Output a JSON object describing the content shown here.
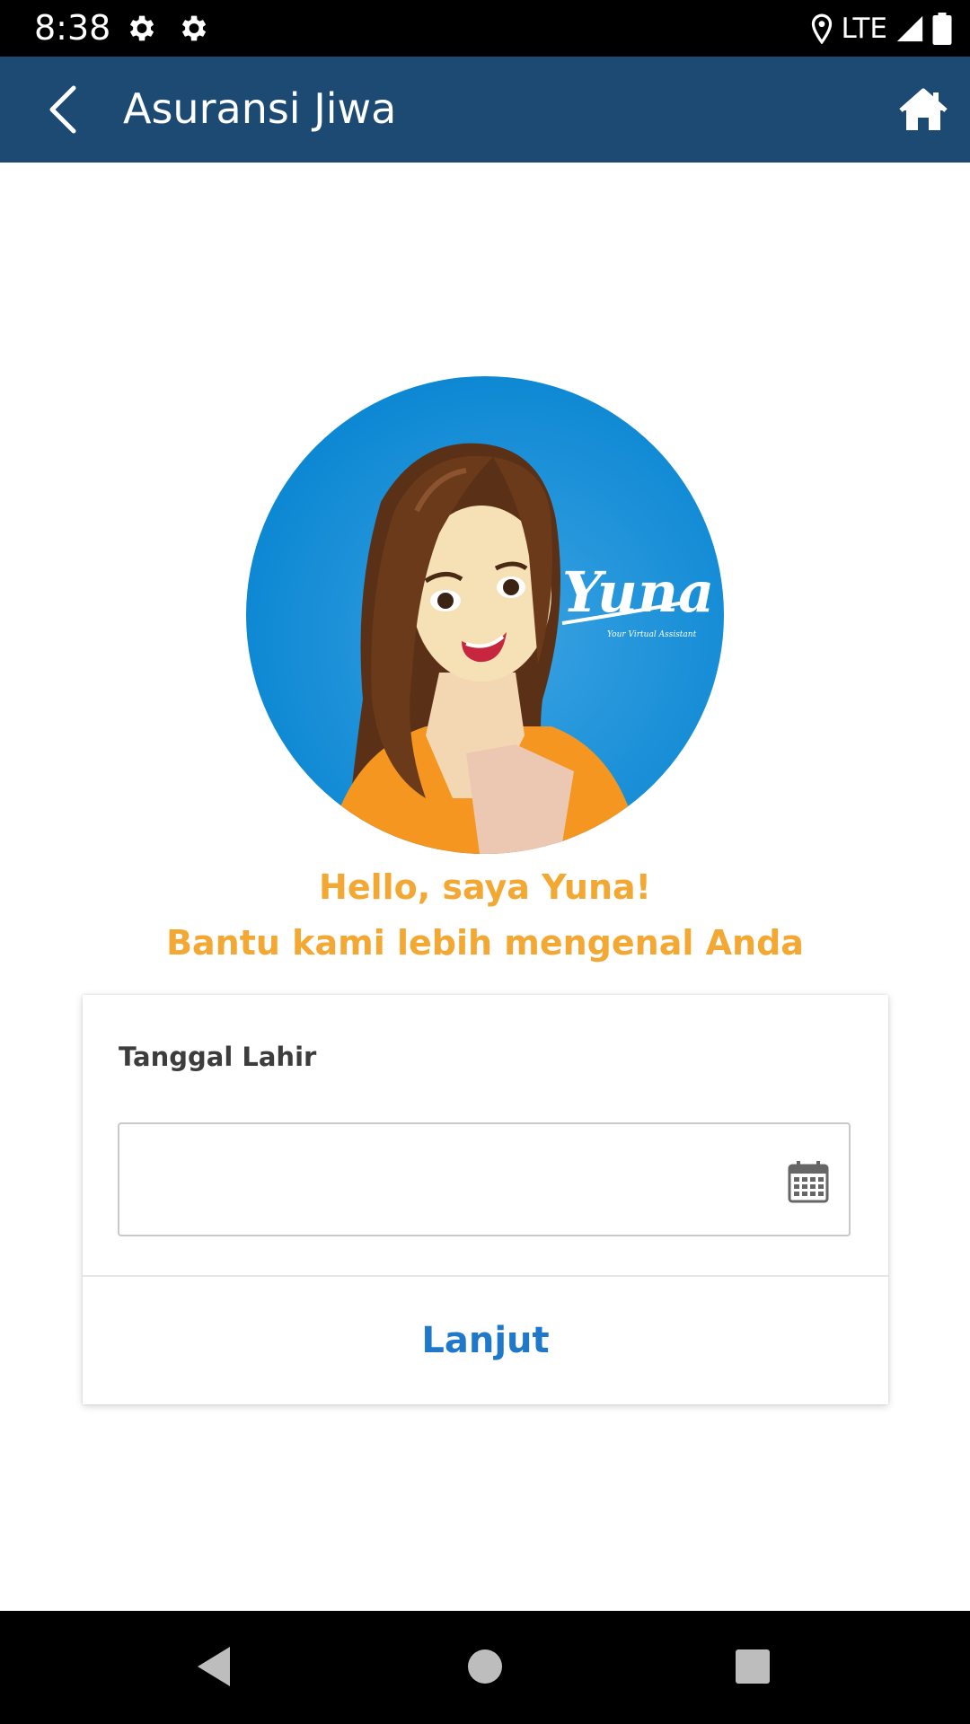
{
  "status_bar": {
    "time": "8:38",
    "network": "LTE",
    "icons": [
      "gear-icon",
      "gear-icon",
      "location-icon",
      "signal-icon",
      "battery-icon"
    ]
  },
  "app_bar": {
    "title": "Asuransi Jiwa",
    "background": "#1c4a73",
    "icons": [
      "back-arrow-icon",
      "home-icon"
    ]
  },
  "assistant": {
    "logo_text": "Yuna",
    "tagline": "Your Virtual Assistant",
    "greeting_line1": "Hello, saya Yuna!",
    "greeting_line2": "Bantu kami lebih mengenal Anda",
    "accent": "#f2a833"
  },
  "form": {
    "label": "Tanggal Lahir",
    "date_value": "",
    "calendar_icon": "calendar-icon",
    "next_label": "Lanjut",
    "next_color": "#1f78c9"
  },
  "nav_bar": {
    "icons": [
      "back-triangle-icon",
      "home-circle-icon",
      "recents-square-icon"
    ]
  }
}
